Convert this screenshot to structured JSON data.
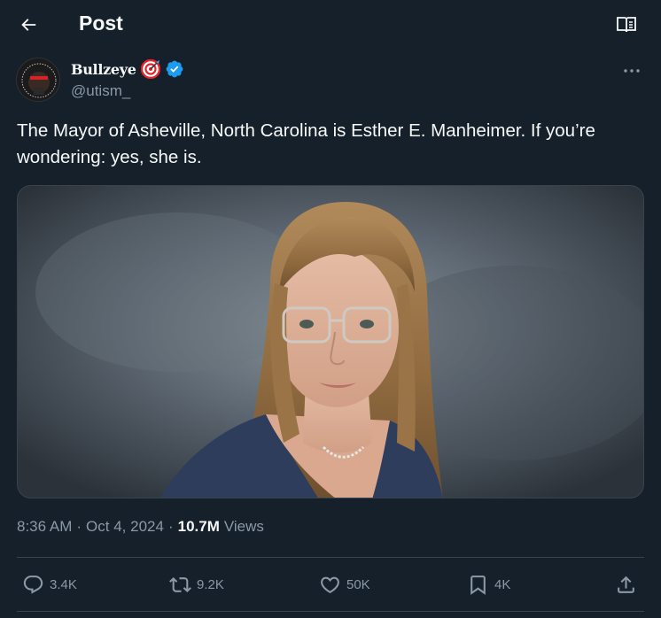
{
  "header": {
    "title": "Post",
    "back_icon": "arrow-left-icon",
    "reader_icon": "reader-mode-icon"
  },
  "author": {
    "display_name": "Bullzeye",
    "handle": "@utism_",
    "badge_icon": "target-emoji-icon",
    "verified_icon": "verified-badge-icon",
    "verified_color": "#1d9bf0"
  },
  "tweet": {
    "text_line1": "The Mayor of Asheville, North Carolina is Esther E. Manheimer. If you’re",
    "text_line2": "wondering: yes, she is."
  },
  "meta": {
    "time": "8:36 AM",
    "separator": "·",
    "date": "Oct 4, 2024",
    "views_count": "10.7M",
    "views_label": "Views"
  },
  "actions": {
    "replies": "3.4K",
    "reposts": "9.2K",
    "likes": "50K",
    "bookmarks": "4K"
  },
  "colors": {
    "background": "#15202b",
    "text": "#f7f9f9",
    "secondary": "#8b98a5",
    "border": "#38444d",
    "accent": "#1d9bf0"
  }
}
